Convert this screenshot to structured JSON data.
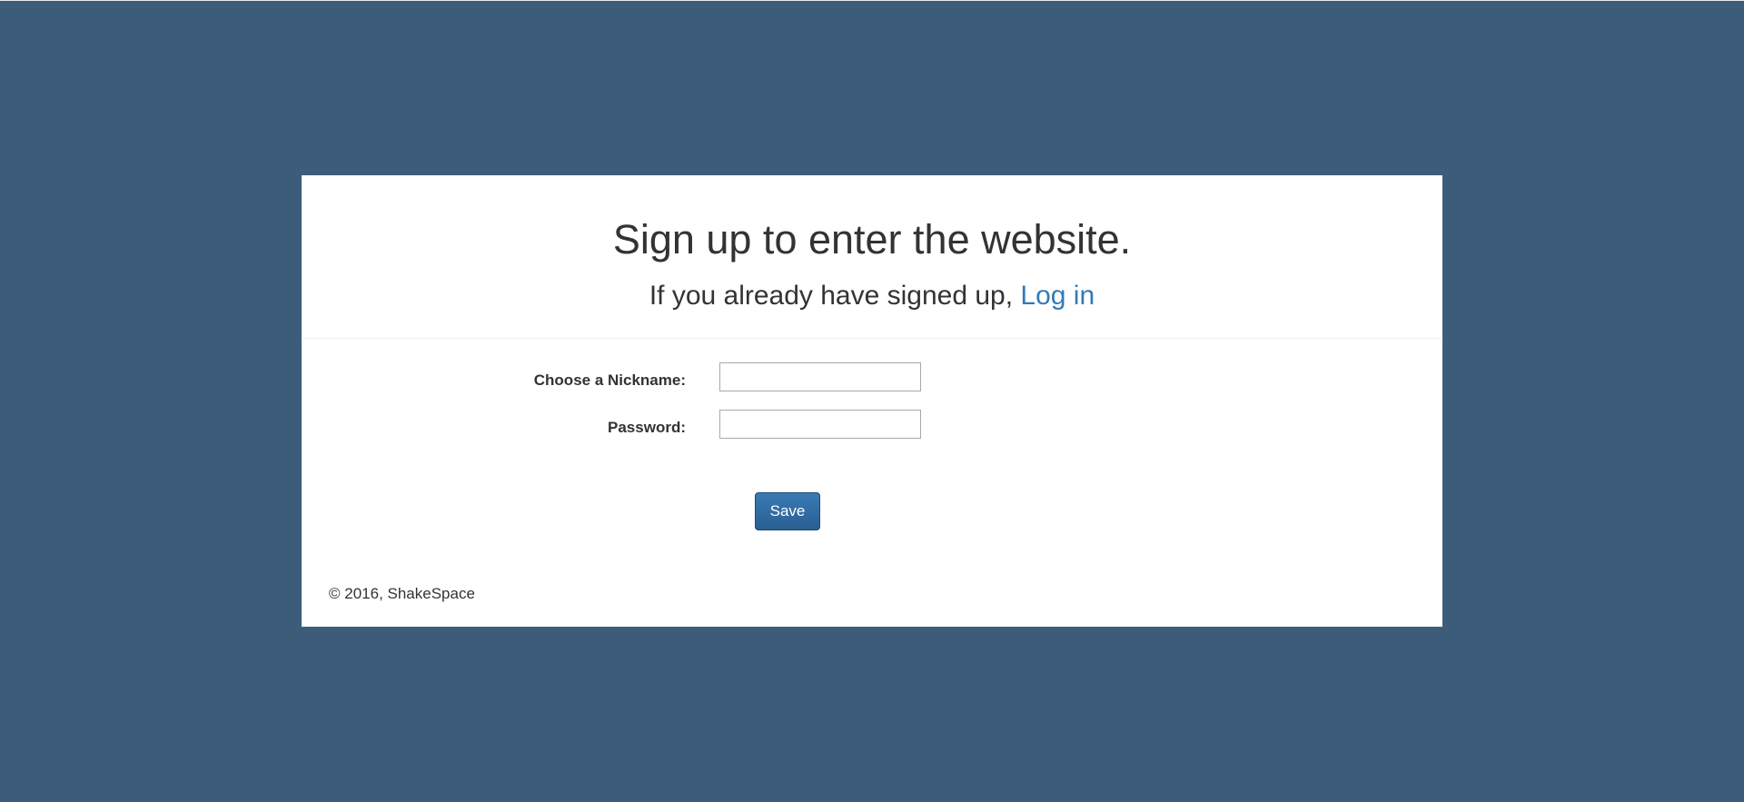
{
  "page": {
    "title": "Sign up to enter the website.",
    "subtitle_text": "If you already have signed up, ",
    "login_link": "Log in"
  },
  "form": {
    "nickname_label": "Choose a Nickname:",
    "nickname_value": "",
    "password_label": "Password:",
    "password_value": "",
    "save_label": "Save"
  },
  "footer": {
    "copyright": "© 2016, ShakeSpace"
  },
  "colors": {
    "background": "#3d5c79",
    "panel": "#ffffff",
    "link": "#337ab7",
    "button": "#2f6da5",
    "text": "#333333"
  }
}
